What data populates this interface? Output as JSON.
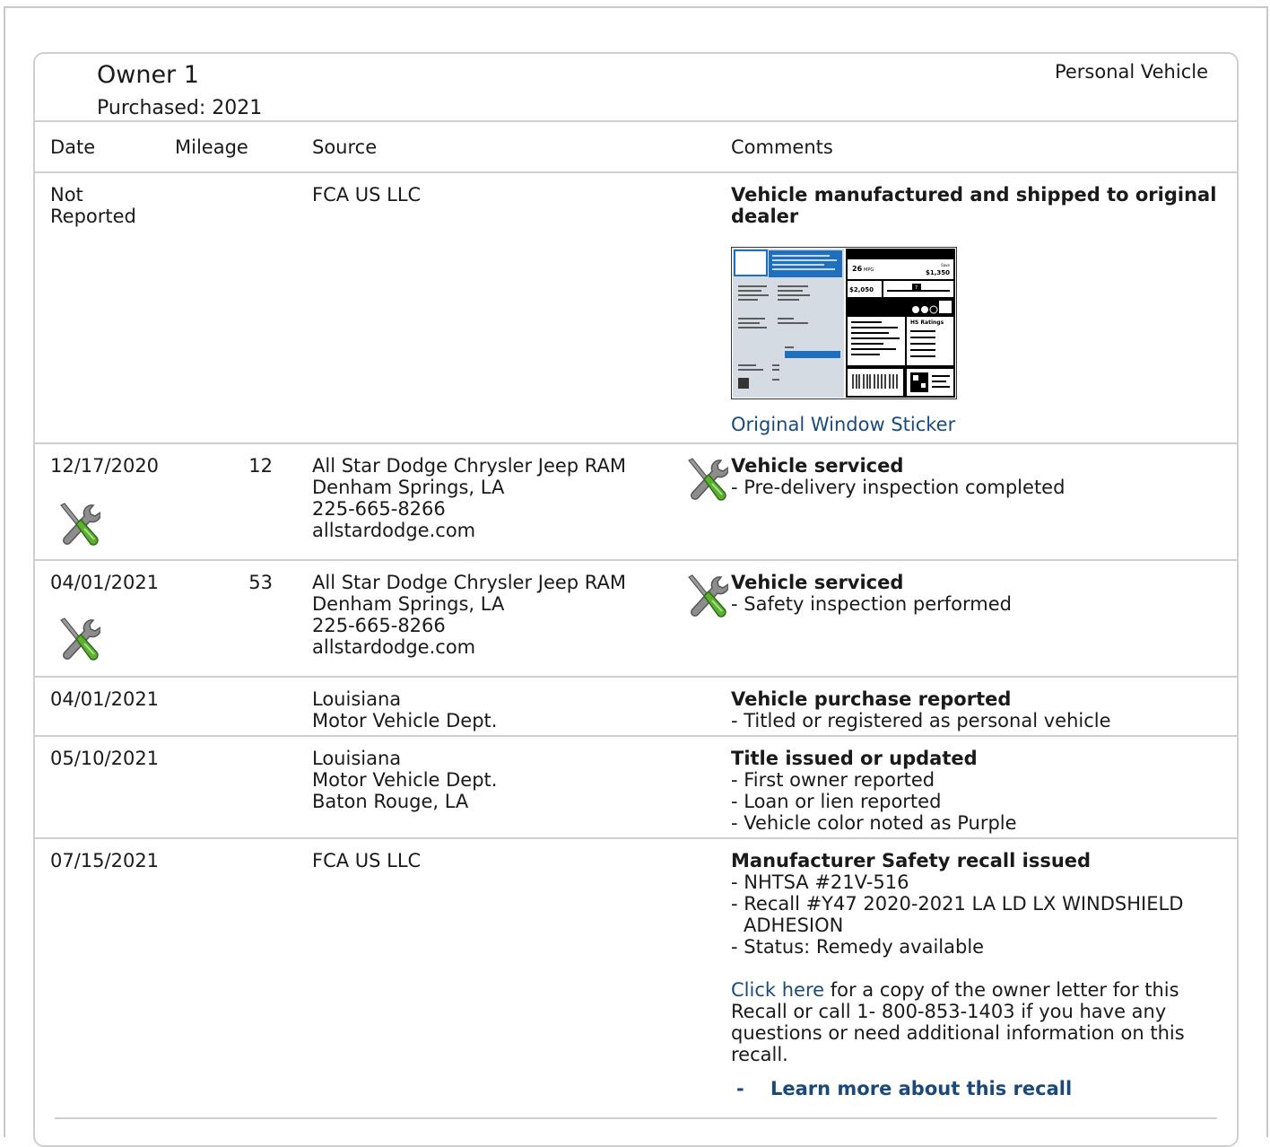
{
  "owner": {
    "title": "Owner 1",
    "purchased": "Purchased: 2021",
    "type": "Personal Vehicle"
  },
  "headers": {
    "date": "Date",
    "mileage": "Mileage",
    "source": "Source",
    "comments": "Comments"
  },
  "records": [
    {
      "date": [
        "Not",
        "Reported"
      ],
      "mileage": "",
      "source": [
        "FCA US LLC"
      ],
      "comment_title": [
        "Vehicle manufactured and shipped to original",
        "dealer"
      ],
      "sticker": {
        "link": "Original Window Sticker",
        "fuel_economy": "26",
        "mpg": "MPG",
        "you_save": "$1,350",
        "annual_cost": "$2,050",
        "rating": "7",
        "hs_ratings": "HS Ratings",
        "label_you": "You",
        "label_save": "Save",
        "label_annual": "annual",
        "label_cost": "COST",
        "label_fuel": "Fuel Economy",
        "label_smog": "Smog",
        "label_gauge_low": "1",
        "label_gauge_high": "10"
      }
    },
    {
      "date": [
        "12/17/2020"
      ],
      "mileage": "12",
      "source": [
        "All Star Dodge Chrysler Jeep RAM",
        "Denham Springs, LA",
        "225-665-8266",
        "allstardodge.com"
      ],
      "comment_title": [
        "Vehicle serviced"
      ],
      "details": [
        "- Pre-delivery inspection completed"
      ]
    },
    {
      "date": [
        "04/01/2021"
      ],
      "mileage": "53",
      "source": [
        "All Star Dodge Chrysler Jeep RAM",
        "Denham Springs, LA",
        "225-665-8266",
        "allstardodge.com"
      ],
      "comment_title": [
        "Vehicle serviced"
      ],
      "details": [
        "- Safety inspection performed"
      ]
    },
    {
      "date": [
        "04/01/2021"
      ],
      "mileage": "",
      "source": [
        "Louisiana",
        "Motor Vehicle Dept."
      ],
      "comment_title": [
        "Vehicle purchase reported"
      ],
      "details": [
        "- Titled or registered as personal vehicle"
      ]
    },
    {
      "date": [
        "05/10/2021"
      ],
      "mileage": "",
      "source": [
        "Louisiana",
        "Motor Vehicle Dept.",
        "Baton Rouge, LA"
      ],
      "comment_title": [
        "Title issued or updated"
      ],
      "details": [
        "- First owner reported",
        "- Loan or lien reported",
        "- Vehicle color noted as Purple"
      ]
    },
    {
      "date": [
        "07/15/2021"
      ],
      "mileage": "",
      "source": [
        "FCA US LLC"
      ],
      "comment_title": [
        "Manufacturer Safety recall issued"
      ],
      "details": [
        "- NHTSA #21V-516",
        "- Recall #Y47 2020-2021 LA LD LX WINDSHIELD",
        "ADHESION",
        "- Status: Remedy available"
      ],
      "recall_link": "Click here",
      "recall_text": [
        " for a copy of the owner letter for this",
        "Recall or call 1- 800-853-1403 if you have any",
        "questions or need additional information on this",
        "recall."
      ],
      "learn_dash": "-",
      "learn_more": "Learn more about this recall"
    }
  ],
  "colors": {
    "link": "#1b4a7a",
    "border": "#cfcfcf",
    "tool_green": "#5cb030"
  },
  "icons": {
    "service": "wrench-screwdriver-icon"
  }
}
